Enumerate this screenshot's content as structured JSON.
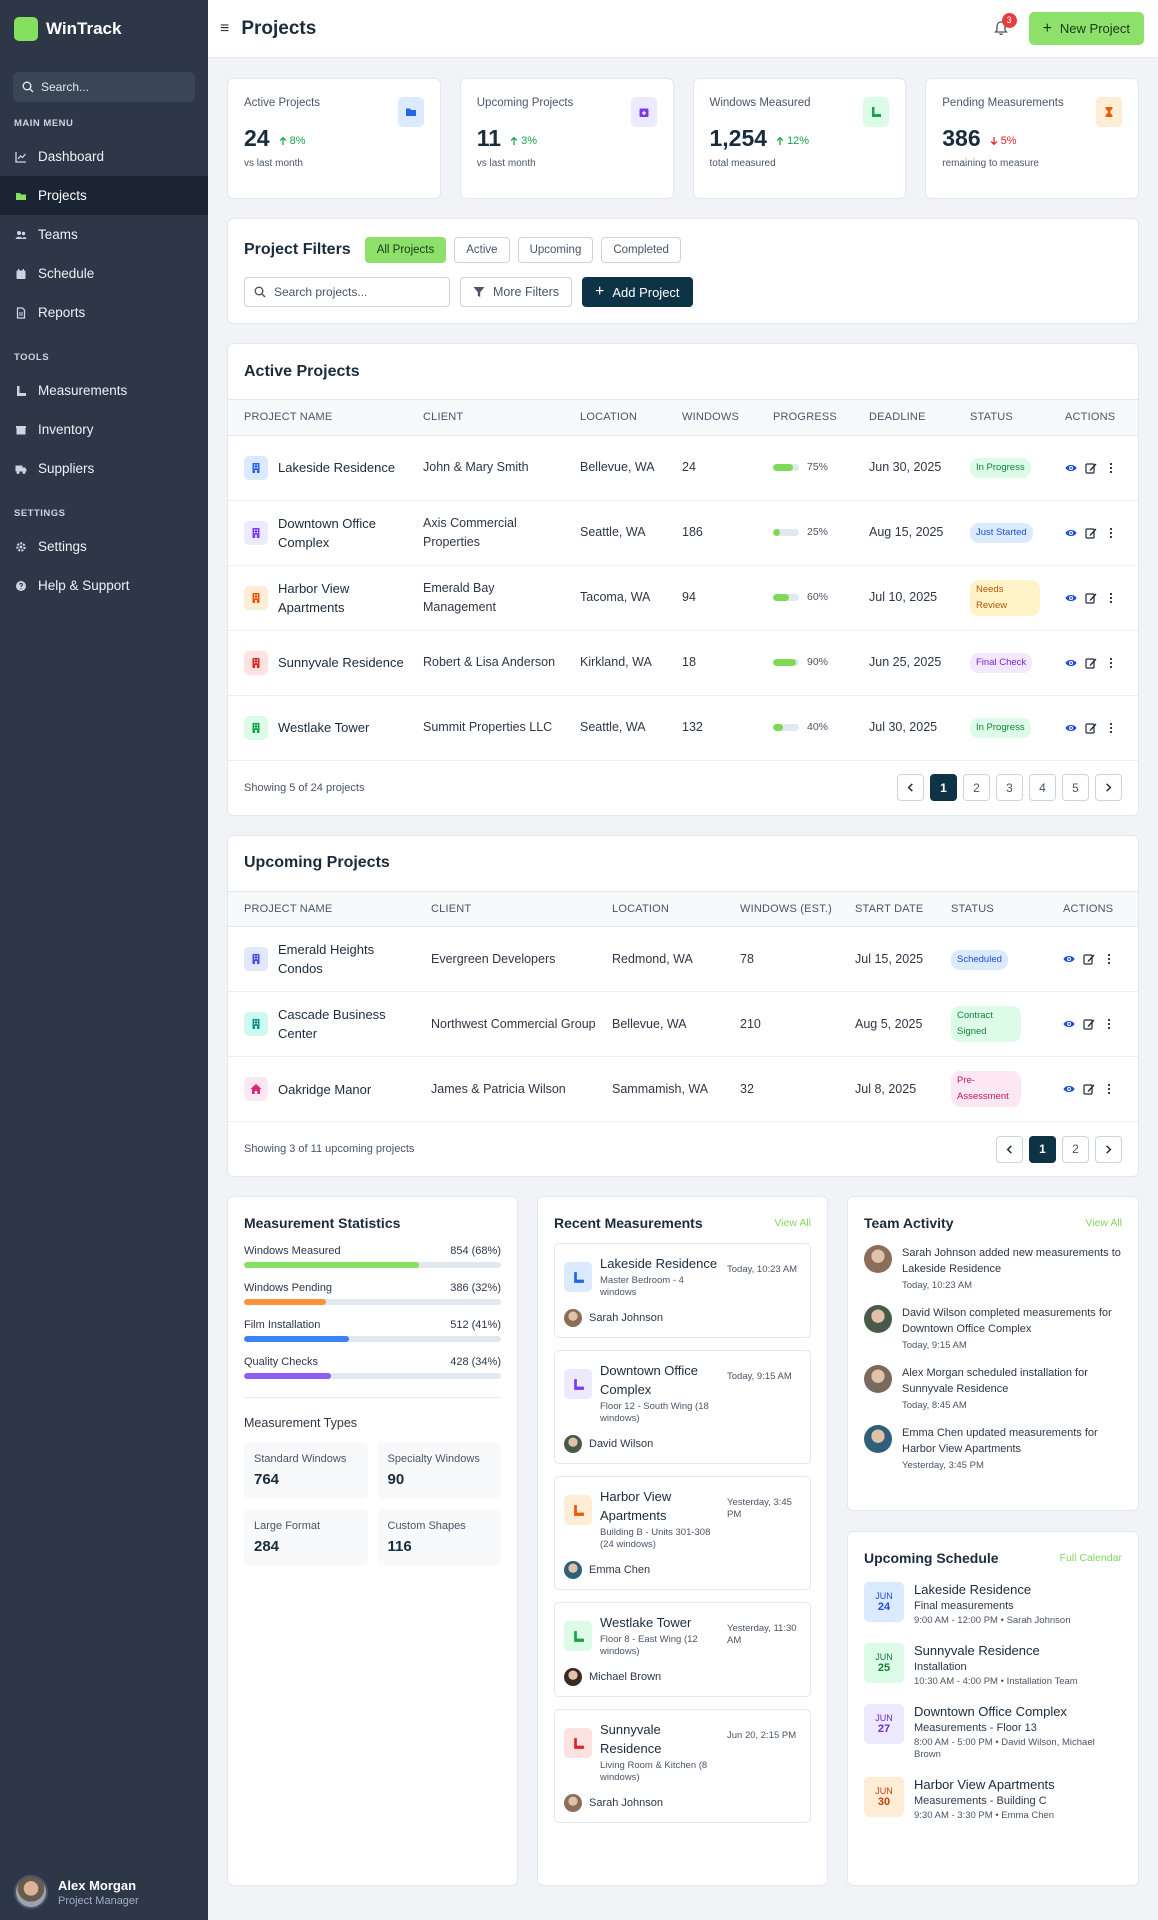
{
  "app": {
    "name": "WinTrack"
  },
  "sidebar": {
    "search_placeholder": "Search...",
    "sections": [
      {
        "title": "MAIN MENU",
        "items": [
          {
            "label": "Dashboard",
            "icon": "chart-line-icon"
          },
          {
            "label": "Projects",
            "icon": "folder-open-icon",
            "active": true
          },
          {
            "label": "Teams",
            "icon": "users-icon"
          },
          {
            "label": "Schedule",
            "icon": "calendar-icon"
          },
          {
            "label": "Reports",
            "icon": "file-icon"
          }
        ]
      },
      {
        "title": "TOOLS",
        "items": [
          {
            "label": "Measurements",
            "icon": "ruler-icon"
          },
          {
            "label": "Inventory",
            "icon": "box-icon"
          },
          {
            "label": "Suppliers",
            "icon": "truck-icon"
          }
        ]
      },
      {
        "title": "SETTINGS",
        "items": [
          {
            "label": "Settings",
            "icon": "gear-icon"
          },
          {
            "label": "Help & Support",
            "icon": "help-icon"
          }
        ]
      }
    ],
    "user": {
      "name": "Alex Morgan",
      "role": "Project Manager"
    }
  },
  "header": {
    "title": "Projects",
    "notifications": "3",
    "new_project_label": "New Project"
  },
  "stats": [
    {
      "label": "Active Projects",
      "value": "24",
      "delta": "8%",
      "direction": "up",
      "sub": "vs last month",
      "icon": "folder-icon",
      "icon_bg": "#dbeafe",
      "icon_color": "#2563eb"
    },
    {
      "label": "Upcoming Projects",
      "value": "11",
      "delta": "3%",
      "direction": "up",
      "sub": "vs last month",
      "icon": "calendar-plus-icon",
      "icon_bg": "#ede9fe",
      "icon_color": "#7c3aed"
    },
    {
      "label": "Windows Measured",
      "value": "1,254",
      "delta": "12%",
      "direction": "up",
      "sub": "total measured",
      "icon": "ruler-icon",
      "icon_bg": "#dcfce7",
      "icon_color": "#16a34a"
    },
    {
      "label": "Pending Measurements",
      "value": "386",
      "delta": "5%",
      "direction": "down",
      "sub": "remaining to measure",
      "icon": "hourglass-icon",
      "icon_bg": "#ffedd5",
      "icon_color": "#ea580c"
    }
  ],
  "filters": {
    "title": "Project Filters",
    "chips": [
      "All Projects",
      "Active",
      "Upcoming",
      "Completed"
    ],
    "search_placeholder": "Search projects...",
    "more_label": "More Filters",
    "add_label": "Add Project"
  },
  "active_projects": {
    "title": "Active Projects",
    "columns": [
      "PROJECT NAME",
      "CLIENT",
      "LOCATION",
      "WINDOWS",
      "PROGRESS",
      "DEADLINE",
      "STATUS",
      "ACTIONS"
    ],
    "rows": [
      {
        "name": "Lakeside Residence",
        "client": "John & Mary Smith",
        "location": "Bellevue, WA",
        "windows": "24",
        "progress": 75,
        "progress_label": "75%",
        "deadline": "Jun 30, 2025",
        "status": "In Progress",
        "status_bg": "#dcfce7",
        "status_fg": "#15803d",
        "icon_bg": "#dbeafe",
        "icon_fg": "#2563eb"
      },
      {
        "name": "Downtown Office Complex",
        "client": "Axis Commercial Properties",
        "location": "Seattle, WA",
        "windows": "186",
        "progress": 25,
        "progress_label": "25%",
        "deadline": "Aug 15, 2025",
        "status": "Just Started",
        "status_bg": "#dbeafe",
        "status_fg": "#1d4ed8",
        "icon_bg": "#ede9fe",
        "icon_fg": "#7c3aed"
      },
      {
        "name": "Harbor View Apartments",
        "client": "Emerald Bay Management",
        "location": "Tacoma, WA",
        "windows": "94",
        "progress": 60,
        "progress_label": "60%",
        "deadline": "Jul 10, 2025",
        "status": "Needs Review",
        "status_bg": "#fef3c7",
        "status_fg": "#b45309",
        "icon_bg": "#ffedd5",
        "icon_fg": "#ea580c"
      },
      {
        "name": "Sunnyvale Residence",
        "client": "Robert & Lisa Anderson",
        "location": "Kirkland, WA",
        "windows": "18",
        "progress": 90,
        "progress_label": "90%",
        "deadline": "Jun 25, 2025",
        "status": "Final Check",
        "status_bg": "#f3e8ff",
        "status_fg": "#7e22ce",
        "icon_bg": "#fee2e2",
        "icon_fg": "#dc2626"
      },
      {
        "name": "Westlake Tower",
        "client": "Summit Properties LLC",
        "location": "Seattle, WA",
        "windows": "132",
        "progress": 40,
        "progress_label": "40%",
        "deadline": "Jul 30, 2025",
        "status": "In Progress",
        "status_bg": "#dcfce7",
        "status_fg": "#15803d",
        "icon_bg": "#dcfce7",
        "icon_fg": "#16a34a"
      }
    ],
    "footer": "Showing 5 of 24 projects",
    "pages": [
      "1",
      "2",
      "3",
      "4",
      "5"
    ]
  },
  "upcoming_projects": {
    "title": "Upcoming Projects",
    "columns": [
      "PROJECT NAME",
      "CLIENT",
      "LOCATION",
      "WINDOWS (EST.)",
      "START DATE",
      "STATUS",
      "ACTIONS"
    ],
    "rows": [
      {
        "name": "Emerald Heights Condos",
        "client": "Evergreen Developers",
        "location": "Redmond, WA",
        "windows": "78",
        "start": "Jul 15, 2025",
        "status": "Scheduled",
        "status_bg": "#dbeafe",
        "status_fg": "#1d4ed8",
        "icon_bg": "#e0e7ff",
        "icon_fg": "#4f46e5"
      },
      {
        "name": "Cascade Business Center",
        "client": "Northwest Commercial Group",
        "location": "Bellevue, WA",
        "windows": "210",
        "start": "Aug 5, 2025",
        "status": "Contract Signed",
        "status_bg": "#dcfce7",
        "status_fg": "#15803d",
        "icon_bg": "#ccfbf1",
        "icon_fg": "#0d9488"
      },
      {
        "name": "Oakridge Manor",
        "client": "James & Patricia Wilson",
        "location": "Sammamish, WA",
        "windows": "32",
        "start": "Jul 8, 2025",
        "status": "Pre-Assessment",
        "status_bg": "#fce7f3",
        "status_fg": "#be185d",
        "icon_bg": "#fce7f3",
        "icon_fg": "#db2777"
      }
    ],
    "footer": "Showing 3 of 11 upcoming projects",
    "pages": [
      "1",
      "2"
    ]
  },
  "measurement_stats": {
    "title": "Measurement Statistics",
    "rows": [
      {
        "label": "Windows Measured",
        "value": "854 (68%)",
        "pct": 68,
        "color": "#84e05e"
      },
      {
        "label": "Windows Pending",
        "value": "386 (32%)",
        "pct": 32,
        "color": "#fb923c"
      },
      {
        "label": "Film Installation",
        "value": "512 (41%)",
        "pct": 41,
        "color": "#3b82f6"
      },
      {
        "label": "Quality Checks",
        "value": "428 (34%)",
        "pct": 34,
        "color": "#8b5cf6"
      }
    ],
    "types_title": "Measurement Types",
    "types": [
      {
        "label": "Standard Windows",
        "value": "764"
      },
      {
        "label": "Specialty Windows",
        "value": "90"
      },
      {
        "label": "Large Format",
        "value": "284"
      },
      {
        "label": "Custom Shapes",
        "value": "116"
      }
    ]
  },
  "recent_measurements": {
    "title": "Recent Measurements",
    "link": "View All",
    "items": [
      {
        "title": "Lakeside Residence",
        "sub": "Master Bedroom - 4 windows",
        "time": "Today, 10:23 AM",
        "user": "Sarah Johnson",
        "icon_bg": "#dbeafe",
        "icon_fg": "#2563eb",
        "avatar": "#8c6d5a"
      },
      {
        "title": "Downtown Office Complex",
        "sub": "Floor 12 - South Wing (18 windows)",
        "time": "Today, 9:15 AM",
        "user": "David Wilson",
        "icon_bg": "#ede9fe",
        "icon_fg": "#7c3aed",
        "avatar": "#4a5a4a"
      },
      {
        "title": "Harbor View Apartments",
        "sub": "Building B - Units 301-308 (24 windows)",
        "time": "Yesterday, 3:45 PM",
        "user": "Emma Chen",
        "icon_bg": "#ffedd5",
        "icon_fg": "#ea580c",
        "avatar": "#2f5f7a"
      },
      {
        "title": "Westlake Tower",
        "sub": "Floor 8 - East Wing (12 windows)",
        "time": "Yesterday, 11:30 AM",
        "user": "Michael Brown",
        "icon_bg": "#dcfce7",
        "icon_fg": "#16a34a",
        "avatar": "#3a2a22"
      },
      {
        "title": "Sunnyvale Residence",
        "sub": "Living Room & Kitchen (8 windows)",
        "time": "Jun 20, 2:15 PM",
        "user": "Sarah Johnson",
        "icon_bg": "#fee2e2",
        "icon_fg": "#dc2626",
        "avatar": "#8c6d5a"
      }
    ]
  },
  "team_activity": {
    "title": "Team Activity",
    "link": "View All",
    "items": [
      {
        "text": "Sarah Johnson added new measurements to Lakeside Residence",
        "time": "Today, 10:23 AM",
        "avatar": "#8c6d5a"
      },
      {
        "text": "David Wilson completed measurements for Downtown Office Complex",
        "time": "Today, 9:15 AM",
        "avatar": "#4a5a4a"
      },
      {
        "text": "Alex Morgan scheduled installation for Sunnyvale Residence",
        "time": "Today, 8:45 AM",
        "avatar": "#7a6a5e"
      },
      {
        "text": "Emma Chen updated measurements for Harbor View Apartments",
        "time": "Yesterday, 3:45 PM",
        "avatar": "#2f5f7a"
      }
    ]
  },
  "upcoming_schedule": {
    "title": "Upcoming Schedule",
    "link": "Full Calendar",
    "items": [
      {
        "month": "JUN",
        "day": "24",
        "title": "Lakeside Residence",
        "sub": "Final measurements",
        "meta": "9:00 AM - 12:00 PM • Sarah Johnson",
        "bg": "#dbeafe",
        "fg": "#1d4ed8"
      },
      {
        "month": "JUN",
        "day": "25",
        "title": "Sunnyvale Residence",
        "sub": "Installation",
        "meta": "10:30 AM - 4:00 PM • Installation Team",
        "bg": "#dcfce7",
        "fg": "#15803d"
      },
      {
        "month": "JUN",
        "day": "27",
        "title": "Downtown Office Complex",
        "sub": "Measurements - Floor 13",
        "meta": "8:00 AM - 5:00 PM • David Wilson, Michael Brown",
        "bg": "#ede9fe",
        "fg": "#6d28d9"
      },
      {
        "month": "JUN",
        "day": "30",
        "title": "Harbor View Apartments",
        "sub": "Measurements - Building C",
        "meta": "9:30 AM - 3:30 PM • Emma Chen",
        "bg": "#ffedd5",
        "fg": "#c2410c"
      }
    ]
  }
}
